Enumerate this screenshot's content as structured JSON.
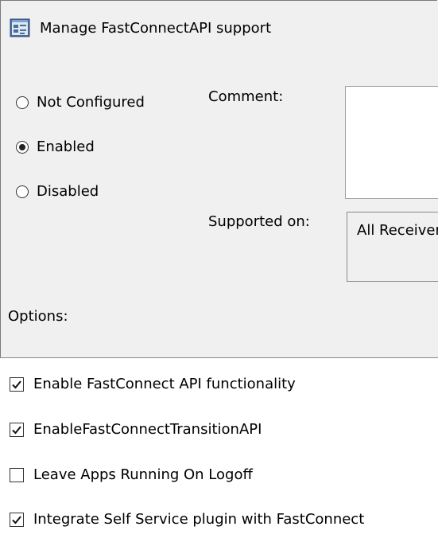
{
  "title": "Manage FastConnectAPI support",
  "state_options": [
    {
      "label": "Not Configured",
      "selected": false
    },
    {
      "label": "Enabled",
      "selected": true
    },
    {
      "label": "Disabled",
      "selected": false
    }
  ],
  "comment": {
    "label": "Comment:",
    "value": ""
  },
  "supported_on": {
    "label": "Supported on:",
    "value": "All Receivers"
  },
  "options_label": "Options:",
  "options": [
    {
      "label": "Enable FastConnect API functionality",
      "checked": true
    },
    {
      "label": "EnableFastConnectTransitionAPI",
      "checked": true
    },
    {
      "label": "Leave Apps Running On Logoff",
      "checked": false
    },
    {
      "label": "Integrate Self Service plugin with FastConnect",
      "checked": true
    }
  ],
  "colors": {
    "background": "#f0f0f0",
    "panel": "#ffffff",
    "border": "#8a8a8a"
  }
}
